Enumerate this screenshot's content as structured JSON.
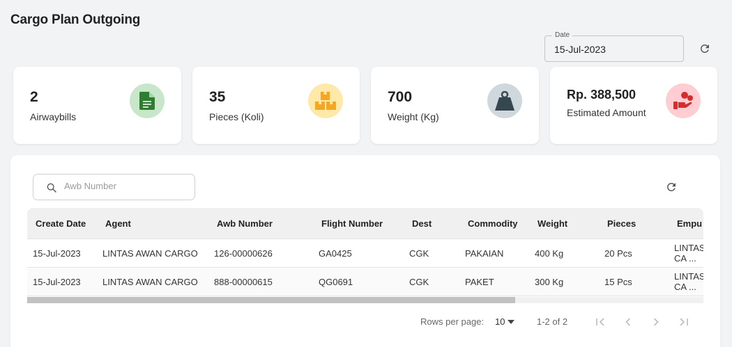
{
  "page": {
    "title": "Cargo Plan Outgoing"
  },
  "date_filter": {
    "label": "Date",
    "value": "15-Jul-2023"
  },
  "cards": [
    {
      "value": "2",
      "label": "Airwaybills",
      "icon": "document-icon",
      "icon_color": "#2e7d32",
      "icon_bg": "#c8e6c9"
    },
    {
      "value": "35",
      "label": "Pieces (Koli)",
      "icon": "boxes-icon",
      "icon_color": "#f5a623",
      "icon_bg": "#ffe9a8"
    },
    {
      "value": "700",
      "label": "Weight (Kg)",
      "icon": "weight-icon",
      "icon_color": "#37474f",
      "icon_bg": "#cfd8dc"
    },
    {
      "value": "Rp. 388,500",
      "label": "Estimated Amount",
      "icon": "hand-coins-icon",
      "icon_color": "#d32f2f",
      "icon_bg": "#ffcdd2"
    }
  ],
  "search": {
    "placeholder": "Awb Number"
  },
  "table": {
    "columns": [
      "Create Date",
      "Agent",
      "Awb Number",
      "Flight Number",
      "Dest",
      "Commodity",
      "Weight",
      "Pieces",
      "Empu"
    ],
    "rows": [
      [
        "15-Jul-2023",
        "LINTAS AWAN CARGO",
        "126-00000626",
        "GA0425",
        "CGK",
        "PAKAIAN",
        "400 Kg",
        "20 Pcs",
        "LINTAS CA ..."
      ],
      [
        "15-Jul-2023",
        "LINTAS AWAN CARGO",
        "888-00000615",
        "QG0691",
        "CGK",
        "PAKET",
        "300 Kg",
        "15 Pcs",
        "LINTAS CA ..."
      ]
    ]
  },
  "pagination": {
    "rows_per_page_label": "Rows per page:",
    "rows_per_page": "10",
    "range": "1-2 of 2"
  }
}
